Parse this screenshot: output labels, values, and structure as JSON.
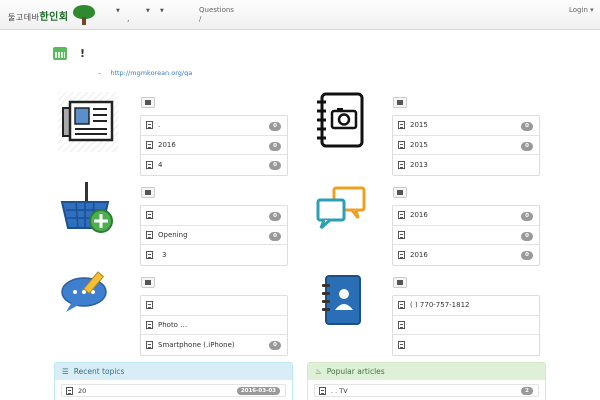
{
  "nav": {
    "brand_prefix": "둘고데바",
    "brand_main": "한인회",
    "dot": ",",
    "questions": "Questions",
    "questions_sub": "/",
    "login": "Login"
  },
  "page": {
    "title": "!",
    "subtitle_dash": "–",
    "subtitle_link": "http://mgmkorean.org/qa"
  },
  "sections": [
    {
      "rows": [
        {
          "text": ".",
          "count": "0"
        },
        {
          "text": "2016",
          "count": "0"
        },
        {
          "text": "4",
          "count": "0"
        }
      ]
    },
    {
      "rows": [
        {
          "text": "2015",
          "count": "0"
        },
        {
          "text": "2015",
          "count": "0"
        },
        {
          "text": "2013",
          "count": ""
        }
      ]
    },
    {
      "rows": [
        {
          "text": "",
          "count": "0"
        },
        {
          "text": "Opening",
          "count": "0"
        },
        {
          "text": "3",
          "count": ""
        }
      ]
    },
    {
      "rows": [
        {
          "text": "2016",
          "count": "0"
        },
        {
          "text": "",
          "count": "0"
        },
        {
          "text": "2016",
          "count": "0"
        }
      ]
    },
    {
      "rows": [
        {
          "text": "",
          "count": ""
        },
        {
          "text": "Photo …",
          "count": ""
        },
        {
          "text": "Smartphone (.iPhone)",
          "count": "0"
        }
      ]
    },
    {
      "rows": [
        {
          "text": "( ) 770-757-1812",
          "count": ""
        },
        {
          "text": "",
          "count": ""
        },
        {
          "text": "",
          "count": ""
        }
      ]
    }
  ],
  "recent": {
    "title": "Recent topics",
    "item_text": "20",
    "item_date": "2016-03-03"
  },
  "popular": {
    "title": "Popular articles",
    "item_text": ". .   TV",
    "item_count": "2"
  }
}
